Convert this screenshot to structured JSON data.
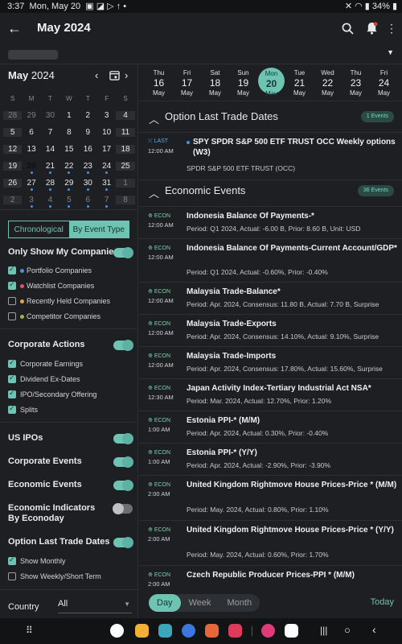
{
  "status": {
    "time": "3:37",
    "date": "Mon, May 20",
    "battery": "34%"
  },
  "appbar": {
    "title": "May 2024"
  },
  "mini_calendar": {
    "month": "May",
    "year": "2024",
    "dow": [
      "S",
      "M",
      "T",
      "W",
      "T",
      "F",
      "S"
    ],
    "weeks": [
      [
        "28",
        "29",
        "30",
        "1",
        "2",
        "3",
        "4"
      ],
      [
        "5",
        "6",
        "7",
        "8",
        "9",
        "10",
        "11"
      ],
      [
        "12",
        "13",
        "14",
        "15",
        "16",
        "17",
        "18"
      ],
      [
        "19",
        "20",
        "21",
        "22",
        "23",
        "24",
        "25"
      ],
      [
        "26",
        "27",
        "28",
        "29",
        "30",
        "31",
        "1"
      ],
      [
        "2",
        "3",
        "4",
        "5",
        "6",
        "7",
        "8"
      ]
    ]
  },
  "filters": {
    "view_chrono": "Chronological",
    "view_type": "By Event Type",
    "only_companies": "Only Show My Companies",
    "portfolio": "Portfolio Companies",
    "watchlist": "Watchlist Companies",
    "recently": "Recently Held Companies",
    "competitor": "Competitor Companies",
    "corporate_actions": "Corporate Actions",
    "corp_earnings": "Corporate Earnings",
    "dividend": "Dividend Ex-Dates",
    "ipo": "IPO/Secondary Offering",
    "splits": "Splits",
    "us_ipos": "US IPOs",
    "corp_events": "Corporate Events",
    "econ_events": "Economic Events",
    "econ_indicators": "Economic Indicators By Econoday",
    "option_last": "Option Last Trade Dates",
    "show_monthly": "Show Monthly",
    "show_weekly": "Show Weekly/Short Term",
    "country_label": "Country",
    "country_value": "All"
  },
  "day_strip": [
    {
      "dow": "Thu",
      "num": "16",
      "mon": "May"
    },
    {
      "dow": "Fri",
      "num": "17",
      "mon": "May"
    },
    {
      "dow": "Sat",
      "num": "18",
      "mon": "May"
    },
    {
      "dow": "Sun",
      "num": "19",
      "mon": "May"
    },
    {
      "dow": "Mon",
      "num": "20",
      "mon": "May"
    },
    {
      "dow": "Tue",
      "num": "21",
      "mon": "May"
    },
    {
      "dow": "Wed",
      "num": "22",
      "mon": "May"
    },
    {
      "dow": "Thu",
      "num": "23",
      "mon": "May"
    },
    {
      "dow": "Fri",
      "num": "24",
      "mon": "May"
    }
  ],
  "sections": {
    "option": {
      "title": "Option Last Trade Dates",
      "badge": "1 Events"
    },
    "econ": {
      "title": "Economic Events",
      "badge": "36 Events"
    }
  },
  "option_event": {
    "tag": "LAST",
    "time": "12:00 AM",
    "name": "SPY SPDR S&P 500 ETF TRUST OCC Weekly options (W3)",
    "detail": "SPDR S&P 500 ETF TRUST (OCC)"
  },
  "econ_events": [
    {
      "tag": "ECON",
      "time": "12:00 AM",
      "name": "Indonesia Balance Of Payments-*",
      "detail": "Period: Q1 2024, Actual: -6.00 B, Prior: 8.60 B, Unit: USD"
    },
    {
      "tag": "ECON",
      "time": "12:00 AM",
      "name": "Indonesia Balance Of Payments-Current Account/GDP*",
      "detail": "Period: Q1 2024, Actual: -0.60%, Prior: -0.40%"
    },
    {
      "tag": "ECON",
      "time": "12:00 AM",
      "name": "Malaysia Trade-Balance*",
      "detail": "Period: Apr. 2024, Consensus: 11.80 B, Actual: 7.70 B, Surprise"
    },
    {
      "tag": "ECON",
      "time": "12:00 AM",
      "name": "Malaysia Trade-Exports",
      "detail": "Period: Apr. 2024, Consensus: 14.10%, Actual: 9.10%, Surprise"
    },
    {
      "tag": "ECON",
      "time": "12:00 AM",
      "name": "Malaysia Trade-Imports",
      "detail": "Period: Apr. 2024, Consensus: 17.80%, Actual: 15.60%, Surprise"
    },
    {
      "tag": "ECON",
      "time": "12:30 AM",
      "name": "Japan Activity Index-Tertiary Industrial Act NSA*",
      "detail": "Period: Mar. 2024, Actual: 12.70%, Prior: 1.20%"
    },
    {
      "tag": "ECON",
      "time": "1:00 AM",
      "name": "Estonia PPI-* (M/M)",
      "detail": "Period: Apr. 2024, Actual: 0.30%, Prior: -0.40%"
    },
    {
      "tag": "ECON",
      "time": "1:00 AM",
      "name": "Estonia PPI-* (Y/Y)",
      "detail": "Period: Apr. 2024, Actual: -2.90%, Prior: -3.90%"
    },
    {
      "tag": "ECON",
      "time": "2:00 AM",
      "name": "United Kingdom Rightmove House Prices-Price * (M/M)",
      "detail": "Period: May. 2024, Actual: 0.80%, Prior: 1.10%"
    },
    {
      "tag": "ECON",
      "time": "2:00 AM",
      "name": "United Kingdom Rightmove House Prices-Price * (Y/Y)",
      "detail": "Period: May. 2024, Actual: 0.60%, Prior: 1.70%"
    },
    {
      "tag": "ECON",
      "time": "2:00 AM",
      "name": "Czech Republic Producer Prices-PPI * (M/M)",
      "detail": ""
    }
  ],
  "view_tabs": {
    "day": "Day",
    "week": "Week",
    "month": "Month",
    "today": "Today"
  },
  "colors": {
    "accent": "#6ec3b3",
    "background": "#1d1f22",
    "econ_tag": "#7fd1a5",
    "last_tag": "#6aa7e8"
  }
}
